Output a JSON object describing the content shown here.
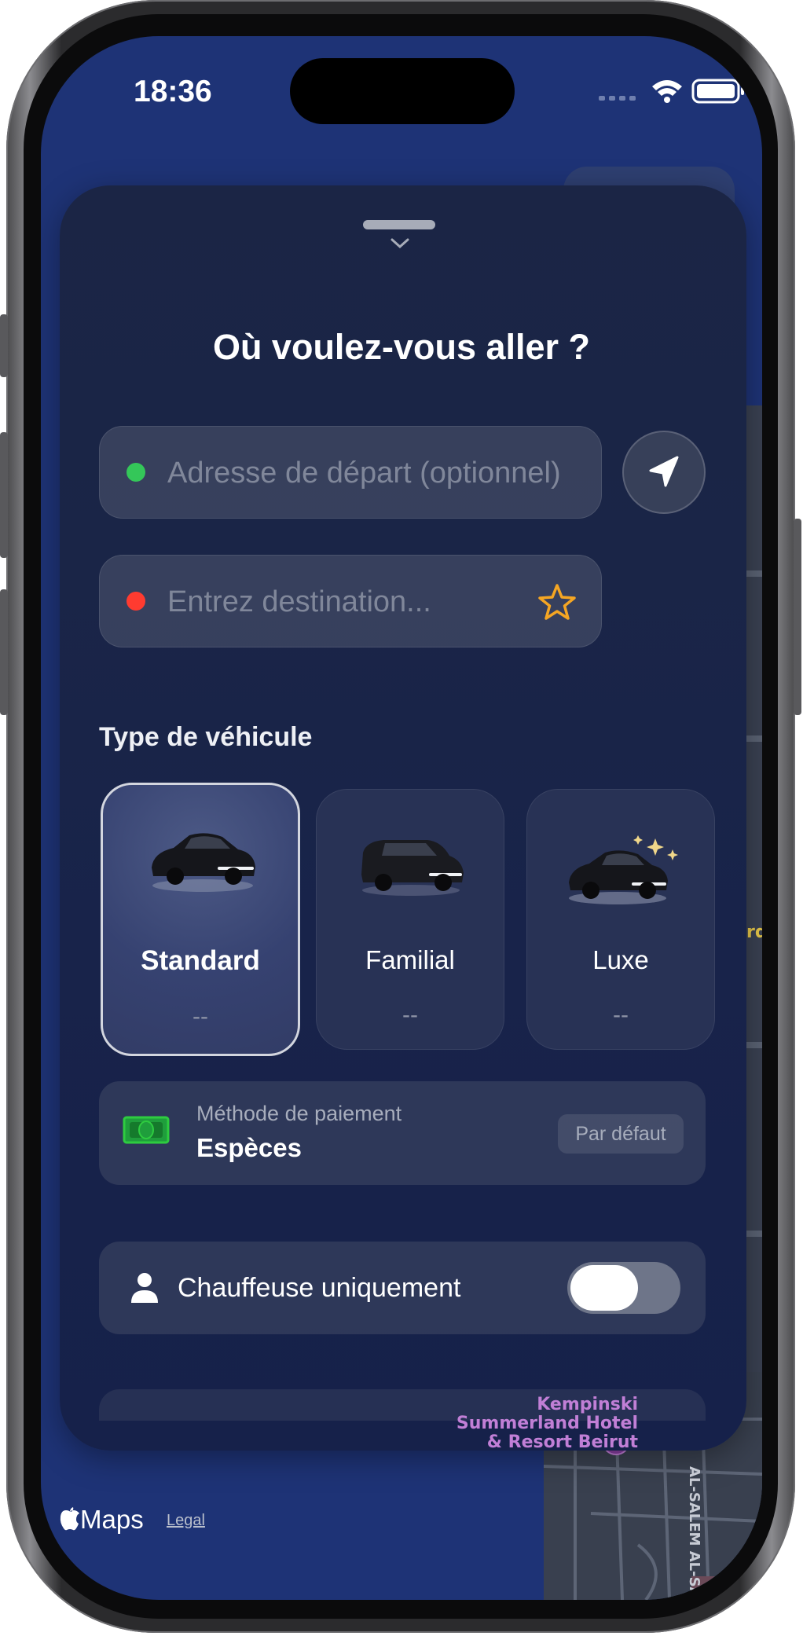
{
  "status_bar": {
    "time": "18:36"
  },
  "sheet": {
    "title": "Où voulez-vous aller ?",
    "pickup": {
      "placeholder": "Adresse de départ (optionnel)"
    },
    "destination": {
      "placeholder": "Entrez destination..."
    },
    "vehicle_section_label": "Type de véhicule",
    "vehicles": [
      {
        "name": "Standard",
        "price": "--",
        "selected": true
      },
      {
        "name": "Familial",
        "price": "--",
        "selected": false
      },
      {
        "name": "Luxe",
        "price": "--",
        "selected": false
      }
    ],
    "payment": {
      "label": "Méthode de paiement",
      "value": "Espèces",
      "badge": "Par défaut"
    },
    "driver_option": {
      "label": "Chauffeuse uniquement",
      "enabled": false
    }
  },
  "map": {
    "poi_name": "Kempinski Summerland Hotel & Resort Beirut",
    "street_label": "AL-SALEM AL-SABAH",
    "attribution": "Maps",
    "legal": "Legal"
  },
  "colors": {
    "pickup_dot": "#34c759",
    "destination_dot": "#ff3b30",
    "favorite_star": "#f5a623",
    "cash_icon": "#2ecc40"
  }
}
